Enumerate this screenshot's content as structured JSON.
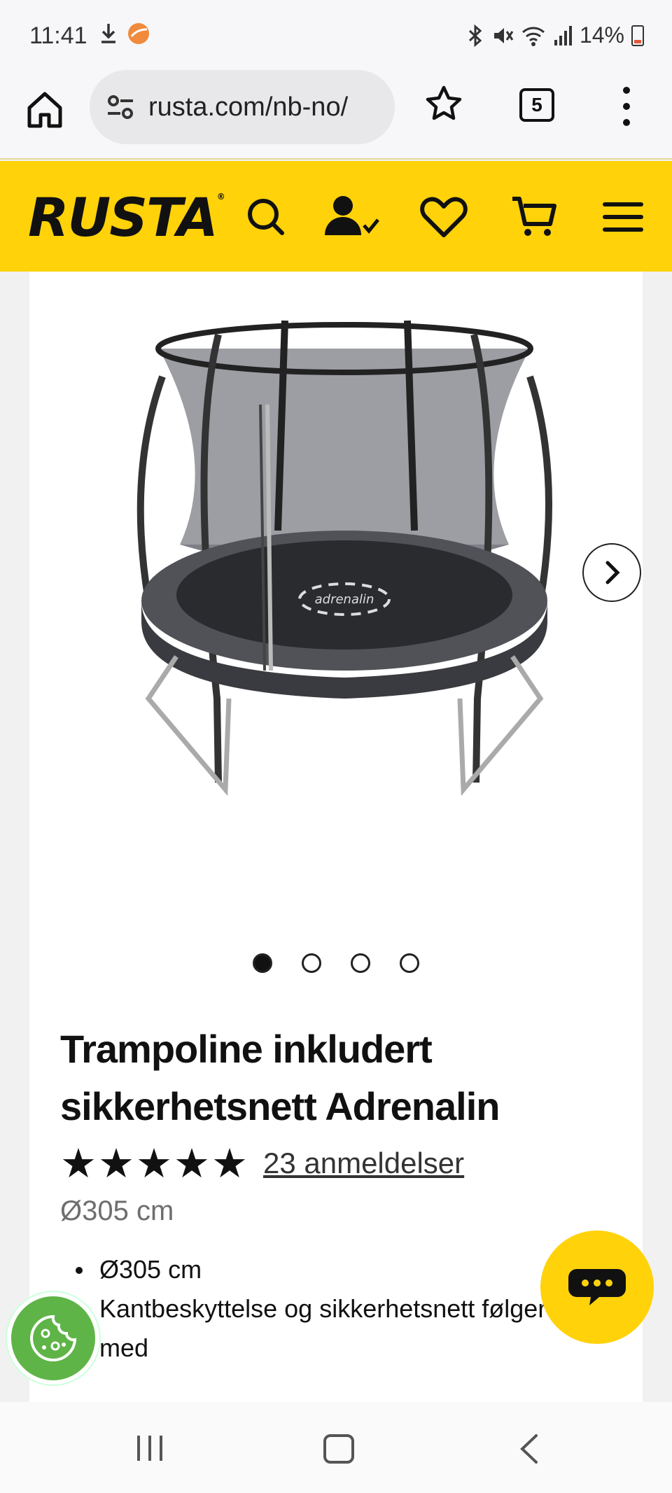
{
  "status_bar": {
    "time": "11:41",
    "battery": "14%",
    "icons": [
      "download-icon",
      "app-icon",
      "bluetooth-icon",
      "mute-icon",
      "wifi-icon",
      "signal-icon",
      "battery-icon"
    ]
  },
  "browser": {
    "url": "rusta.com/nb-no/",
    "tab_count": "5"
  },
  "header": {
    "logo": "RUSTA",
    "logo_mark": "®",
    "accent_color": "#ffd20a"
  },
  "product": {
    "title": "Trampoline inkludert sikkerhetsnett Adrenalin",
    "stars": "★★★★★",
    "rating": 5,
    "reviews": "23 anmeldelser",
    "size": "Ø305 cm",
    "image_logo": "adrenalin",
    "gallery": {
      "count": 4,
      "active": 1
    },
    "bullets": [
      "Ø305 cm",
      "Kantbeskyttelse og sikkerhetsnett følger med"
    ]
  }
}
